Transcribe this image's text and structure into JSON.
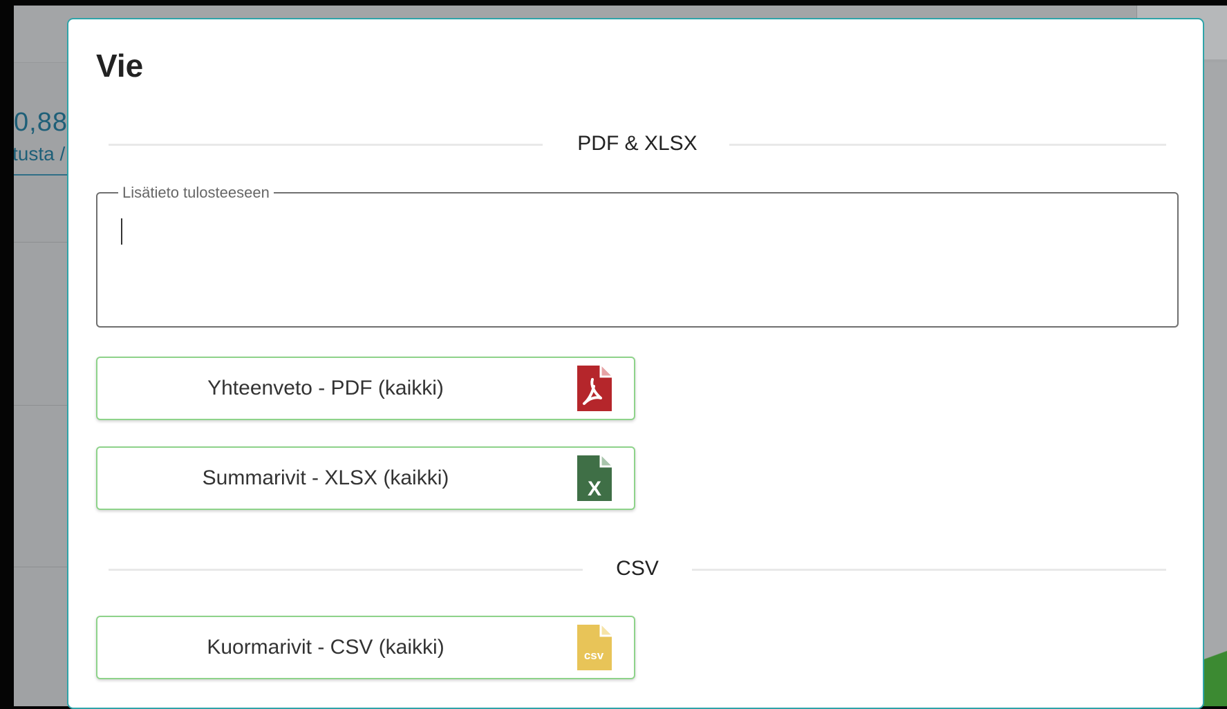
{
  "background": {
    "stat_value": "0,88",
    "stat_sub": "tusta /"
  },
  "modal": {
    "title": "Vie",
    "section_pdf_xlsx": "PDF & XLSX",
    "notes_field": {
      "legend": "Lisätieto tulosteeseen",
      "value": ""
    },
    "buttons": {
      "summary_pdf": "Yhteenveto - PDF (kaikki)",
      "summary_rows_xlsx": "Summarivit - XLSX (kaikki)",
      "load_rows_csv": "Kuormarivit - CSV (kaikki)"
    },
    "section_csv": "CSV",
    "icons": {
      "pdf": "pdf-file-icon",
      "xlsx": "excel-file-icon",
      "csv": "csv-file-icon",
      "xlsx_glyph": "X",
      "csv_glyph": "csv"
    },
    "colors": {
      "pdf": "#b5262b",
      "xlsx": "#3f6f46",
      "csv": "#e8c458",
      "button_border": "#8ed38a",
      "modal_border": "#2ea3a8"
    }
  }
}
